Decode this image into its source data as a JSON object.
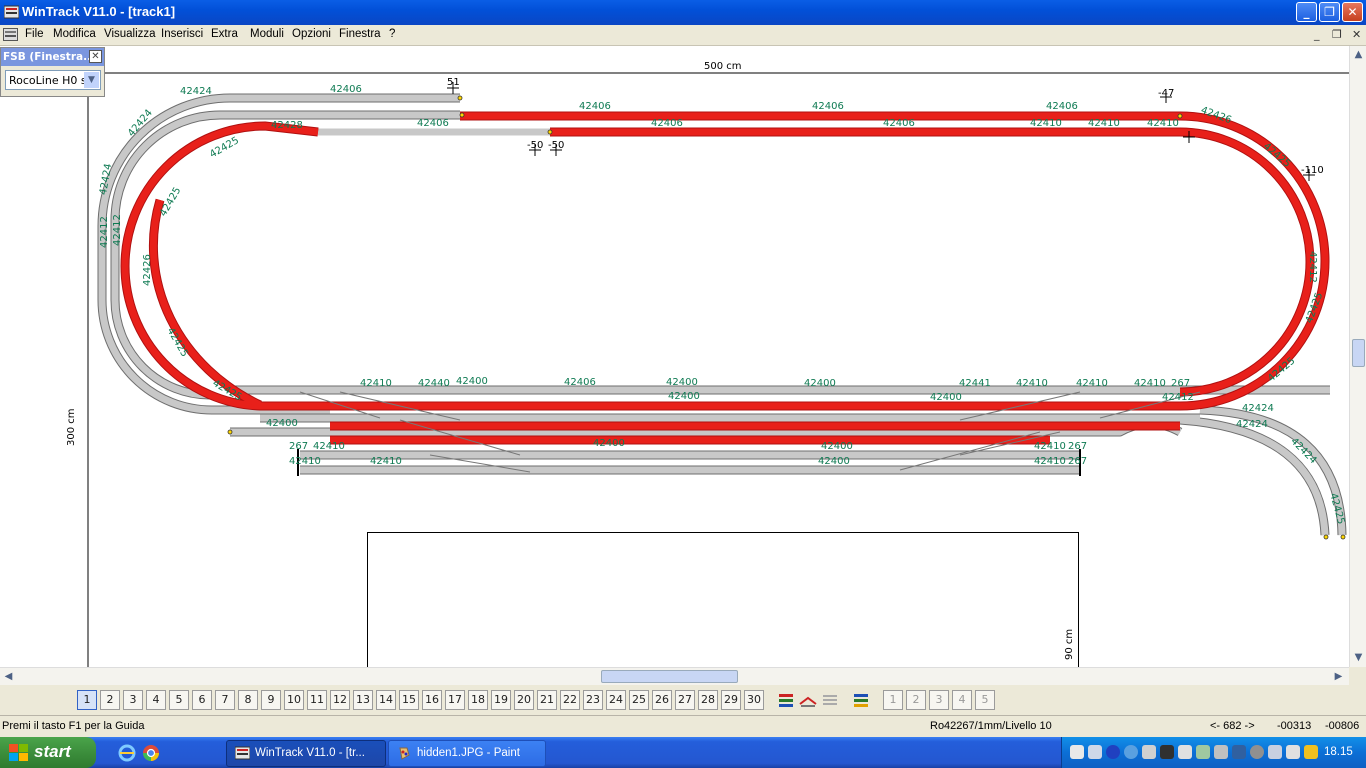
{
  "window": {
    "title": "WinTrack  V11.0 - [track1]"
  },
  "menu": [
    "File",
    "Modifica",
    "Visualizza",
    "Inserisci",
    "Extra",
    "Moduli",
    "Opzioni",
    "Finestra",
    "?"
  ],
  "fsb": {
    "title": "FSB (Finestra...",
    "selected": "RocoLine H0 se"
  },
  "canvas": {
    "dim_width": "500 cm",
    "dim_height": "300 cm",
    "dim_box": "90 cm",
    "heights": [
      "51",
      "-47",
      "-50",
      "-50",
      "-110"
    ],
    "track_labels": [
      "42406",
      "42406",
      "42406",
      "42406",
      "42406",
      "42406",
      "42406",
      "42406",
      "42410",
      "42410",
      "42410",
      "42410",
      "42410",
      "42410",
      "42410",
      "42410",
      "42410",
      "42410",
      "42410",
      "42410",
      "42412",
      "42412",
      "42412",
      "42412",
      "42424",
      "42424",
      "42424",
      "42424",
      "42424",
      "42424",
      "42425",
      "42425",
      "42425",
      "42425",
      "42425",
      "42425",
      "42425",
      "42425",
      "42426",
      "42426",
      "42428",
      "42400",
      "42400",
      "42400",
      "42400",
      "42400",
      "42400",
      "42400",
      "42400",
      "42400",
      "42440",
      "42441",
      "267",
      "267",
      "267",
      "267",
      "267"
    ]
  },
  "layers": {
    "buttons": [
      "1",
      "2",
      "3",
      "4",
      "5",
      "6",
      "7",
      "8",
      "9",
      "10",
      "11",
      "12",
      "13",
      "14",
      "15",
      "16",
      "17",
      "18",
      "19",
      "20",
      "21",
      "22",
      "23",
      "24",
      "25",
      "26",
      "27",
      "28",
      "29",
      "30"
    ],
    "active": "1",
    "module_buttons": [
      "1",
      "2",
      "3",
      "4",
      "5"
    ]
  },
  "status": {
    "help": "Premi il tasto F1 per la Guida",
    "part": "Ro42267/1mm/Livello 10",
    "angle": "<- 682 ->",
    "x": "-00313",
    "y": "-00806"
  },
  "taskbar": {
    "start": "start",
    "tasks": [
      "WinTrack  V11.0 - [tr...",
      "hidden1.JPG - Paint"
    ],
    "clock": "18.15"
  },
  "colors": {
    "title_bar": "#0a5ee6",
    "track_active": "#e8201a",
    "track_inactive": "#c8c8c8",
    "label": "#0e7a52"
  }
}
